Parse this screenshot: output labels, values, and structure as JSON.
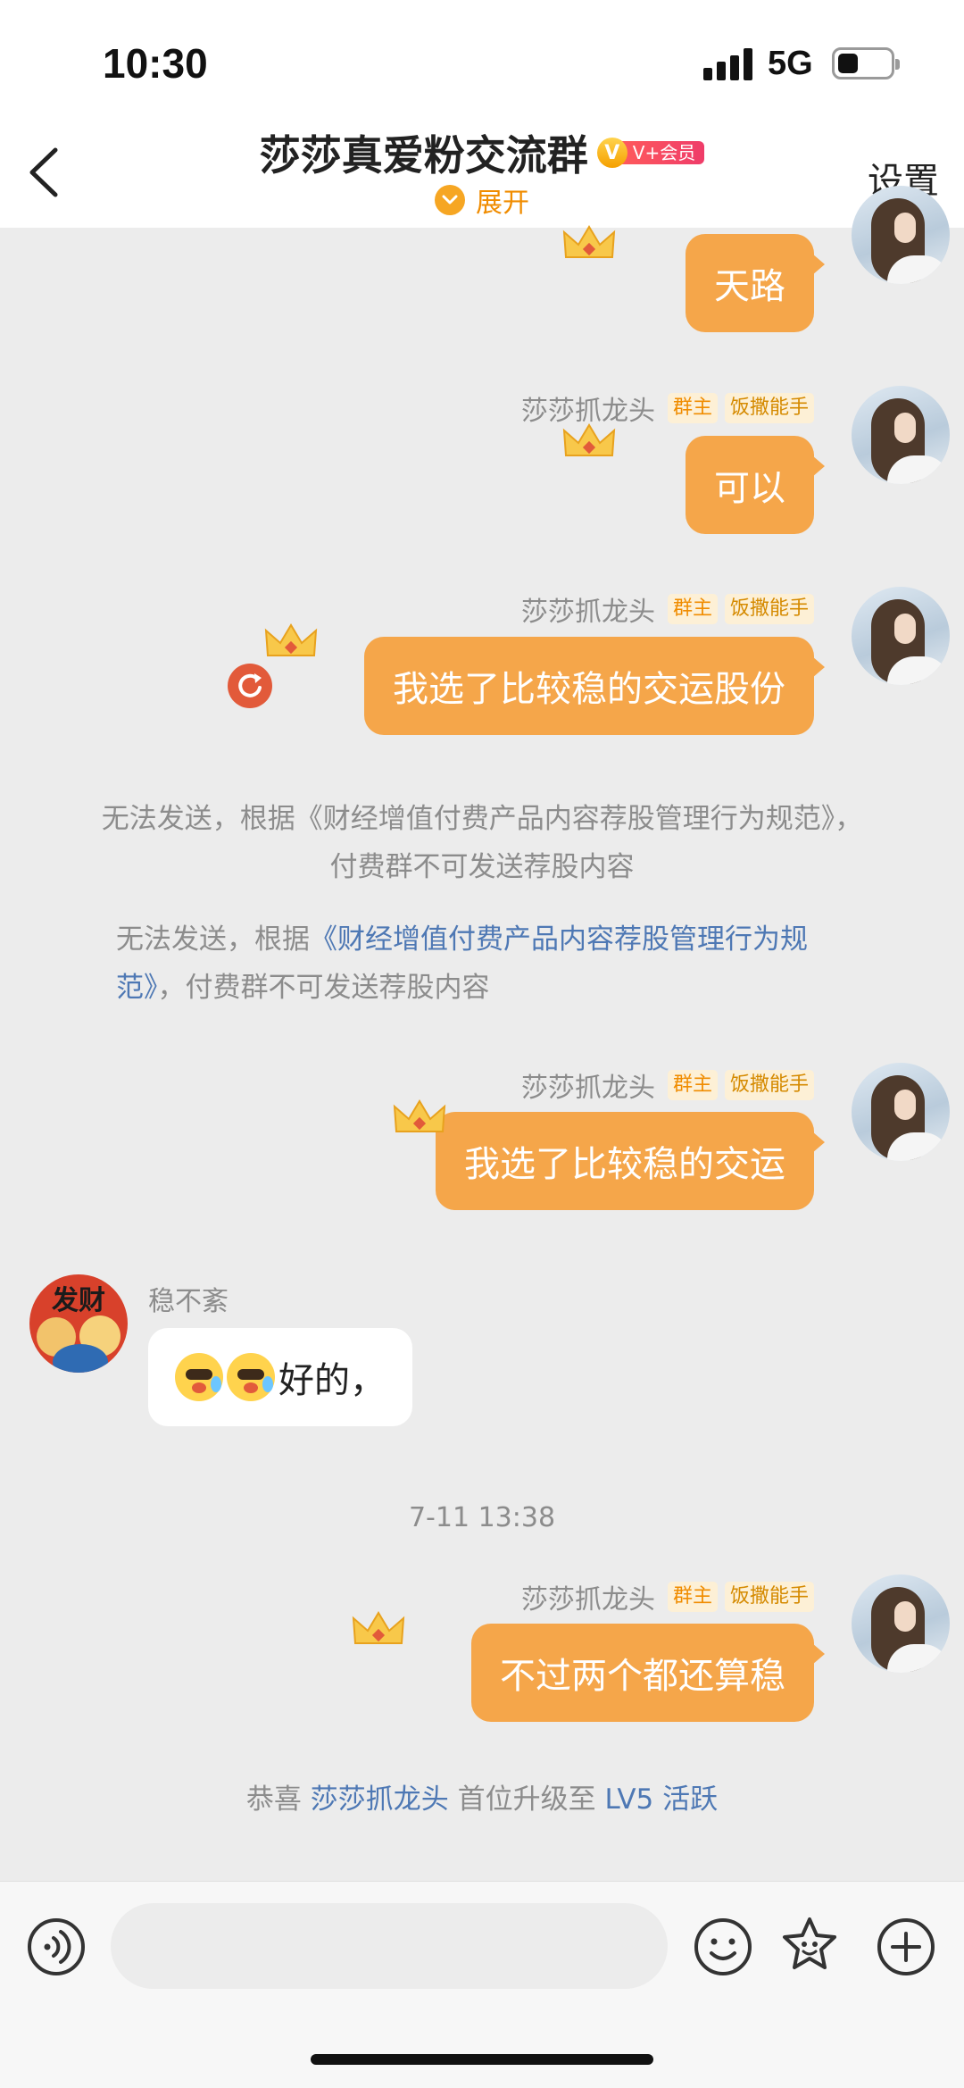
{
  "status_bar": {
    "time": "10:30",
    "network": "5G",
    "battery_percent": 40
  },
  "header": {
    "title": "莎莎真爱粉交流群",
    "vip_badge": "V+会员",
    "vip_mark": "V",
    "expand_label": "展开",
    "settings_label": "设置"
  },
  "messages": [
    {
      "sender": "莎莎抓龙头",
      "badges": [
        "群主",
        "饭撒能手"
      ],
      "text": "天路",
      "side": "right"
    },
    {
      "sender": "莎莎抓龙头",
      "badges": [
        "群主",
        "饭撒能手"
      ],
      "text": "可以",
      "side": "right"
    },
    {
      "sender": "莎莎抓龙头",
      "badges": [
        "群主",
        "饭撒能手"
      ],
      "text": "我选了比较稳的交运股份",
      "side": "right",
      "failed": true
    },
    {
      "sender": "莎莎抓龙头",
      "badges": [
        "群主",
        "饭撒能手"
      ],
      "text": "我选了比较稳的交运",
      "side": "right"
    },
    {
      "sender": "稳不紊",
      "text": "好的，",
      "side": "left",
      "emoji_count": 2
    },
    {
      "sender": "莎莎抓龙头",
      "badges": [
        "群主",
        "饭撒能手"
      ],
      "text": "不过两个都还算稳",
      "side": "right"
    }
  ],
  "system": {
    "notice1": "无法发送，根据《财经增值付费产品内容荐股管理行为规范》，付费群不可发送荐股内容",
    "notice2_prefix": "无法发送，根据",
    "notice2_link": "《财经增值付费产品内容荐股管理行为规范》",
    "notice2_suffix": "，付费群不可发送荐股内容",
    "timestamp": "7-11 13:38",
    "upgrade_prefix": "恭喜 ",
    "upgrade_user": "莎莎抓龙头",
    "upgrade_mid": " 首位升级至 ",
    "upgrade_level": "LV5 活跃"
  },
  "avatar_text": "发财",
  "input_bar": {
    "placeholder": "",
    "icons": [
      "voice-icon",
      "emoji-icon",
      "sticker-icon",
      "plus-icon"
    ]
  },
  "colors": {
    "accent": "#f5a64a",
    "owner_tag": "#f08c00",
    "link": "#4e78b4",
    "background": "#ececec"
  }
}
